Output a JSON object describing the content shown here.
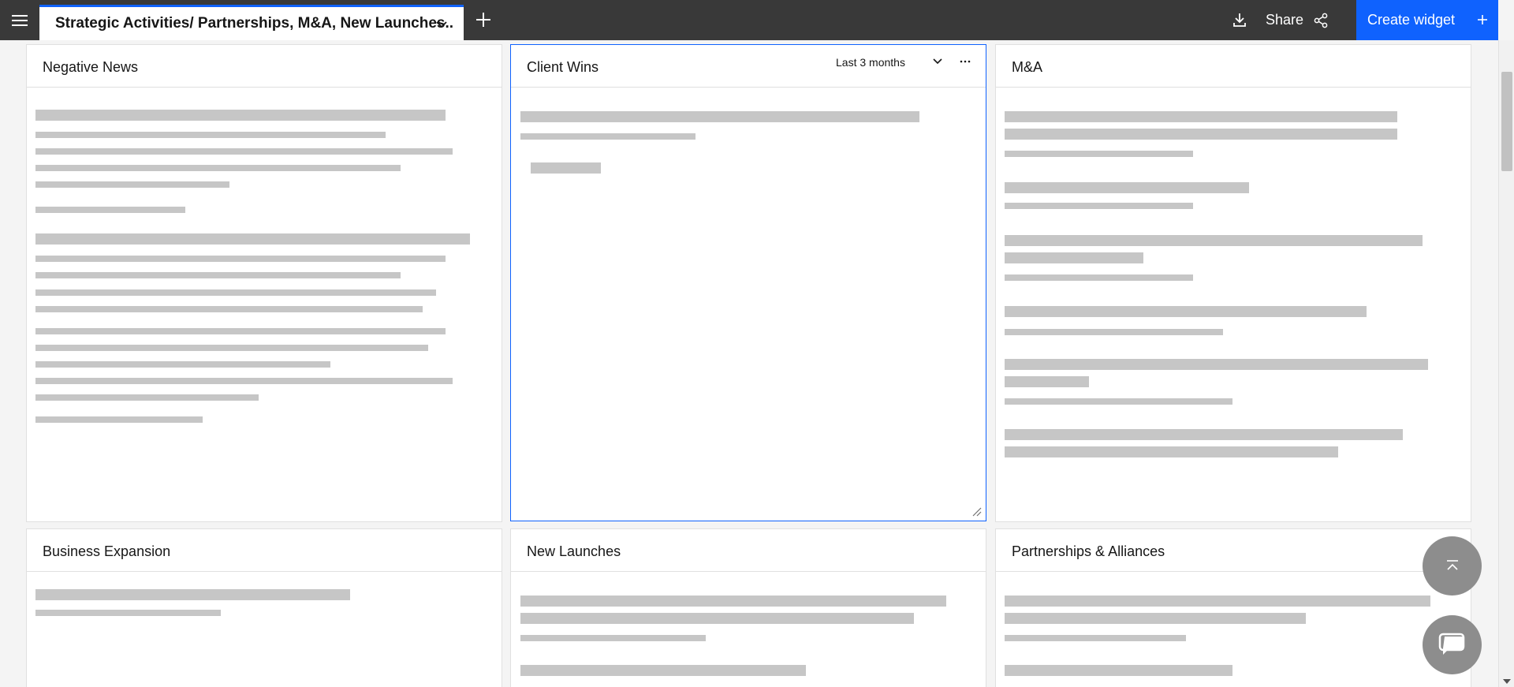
{
  "topbar": {
    "active_tab_title": "Strategic Activities/ Partnerships, M&A, New Launches..",
    "share_label": "Share",
    "create_widget_label": "Create widget"
  },
  "widgets": {
    "negative_news": {
      "title": "Negative News"
    },
    "client_wins": {
      "title": "Client Wins",
      "time_range": "Last 3 months"
    },
    "ma": {
      "title": "M&A"
    },
    "business_expansion": {
      "title": "Business Expansion"
    },
    "new_launches": {
      "title": "New Launches"
    },
    "partnerships": {
      "title": "Partnerships & Alliances"
    }
  },
  "colors": {
    "topbar": "#393939",
    "accent": "#0f62fe",
    "skeleton": "#c6c6c6",
    "fab": "#8d8d8d"
  }
}
